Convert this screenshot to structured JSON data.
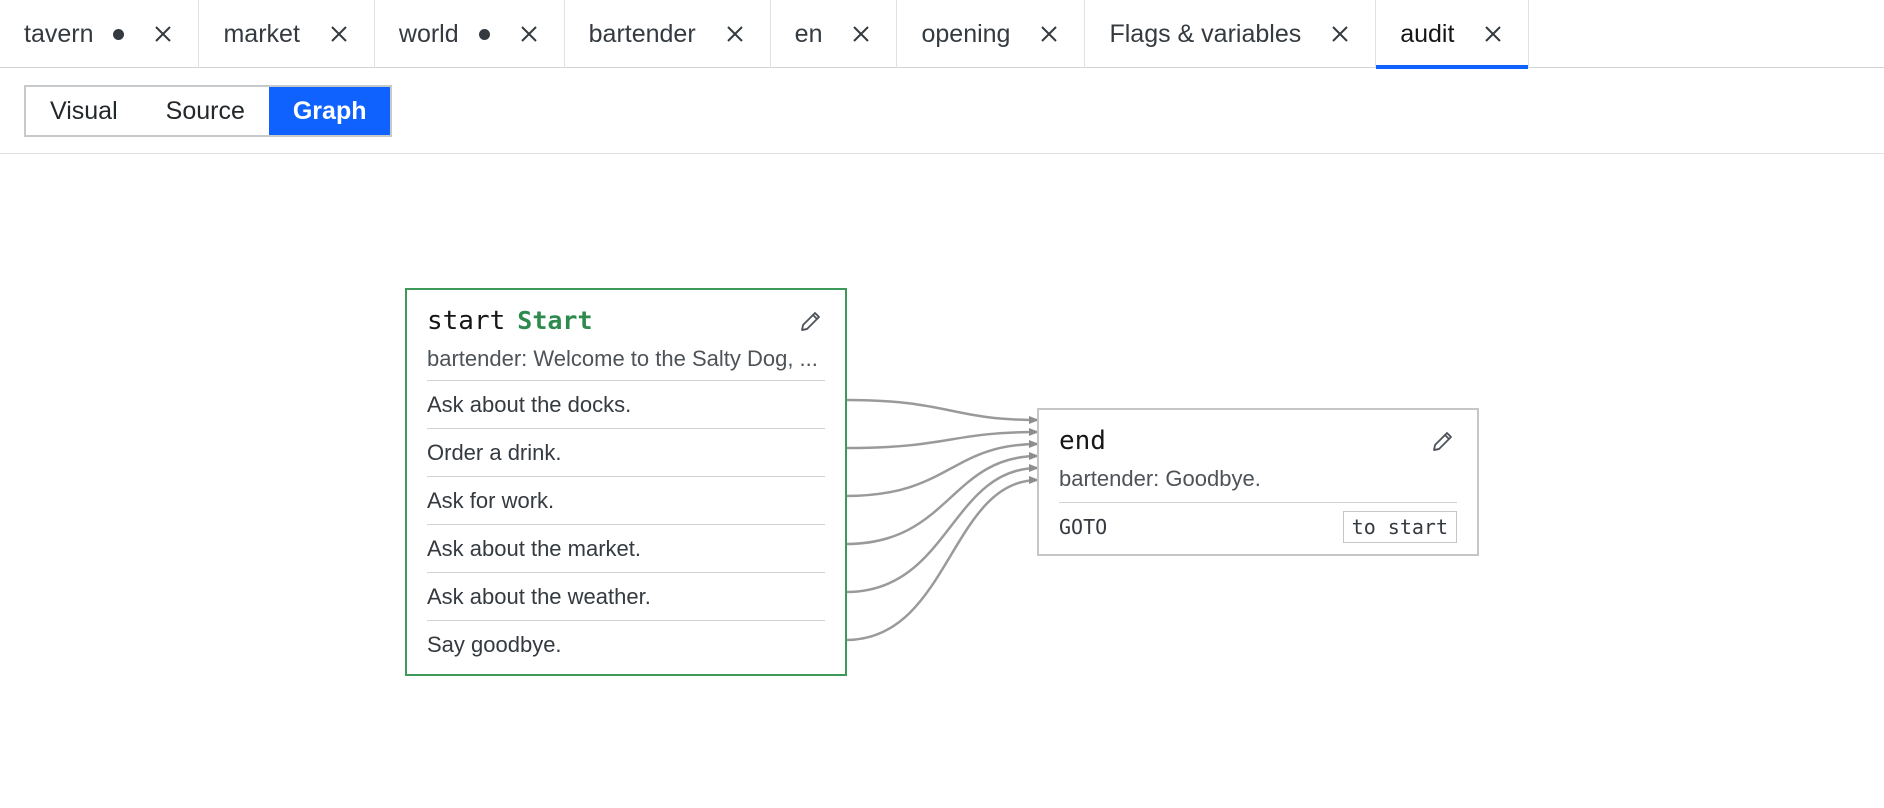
{
  "tabs": [
    {
      "label": "tavern",
      "dirty": true,
      "active": false
    },
    {
      "label": "market",
      "dirty": false,
      "active": false
    },
    {
      "label": "world",
      "dirty": true,
      "active": false
    },
    {
      "label": "bartender",
      "dirty": false,
      "active": false
    },
    {
      "label": "en",
      "dirty": false,
      "active": false
    },
    {
      "label": "opening",
      "dirty": false,
      "active": false
    },
    {
      "label": "Flags & variables",
      "dirty": false,
      "active": false
    },
    {
      "label": "audit",
      "dirty": false,
      "active": true
    }
  ],
  "view_switch": {
    "visual": "Visual",
    "source": "Source",
    "graph": "Graph",
    "selected": "Graph"
  },
  "graph": {
    "start_node": {
      "id": "start",
      "badge": "Start",
      "summary": "bartender: Welcome to the Salty Dog, ...",
      "choices": [
        "Ask about the docks.",
        "Order a drink.",
        "Ask for work.",
        "Ask about the market.",
        "Ask about the weather.",
        "Say goodbye."
      ]
    },
    "end_node": {
      "id": "end",
      "summary": "bartender: Goodbye.",
      "goto_keyword": "GOTO",
      "goto_target": "to start"
    },
    "colors": {
      "start_border": "#3d9a5b",
      "start_badge": "#2e8a4f",
      "node_border": "#c6c6c6",
      "edge": "#9a9a9a",
      "accent": "#0f62fe"
    }
  }
}
